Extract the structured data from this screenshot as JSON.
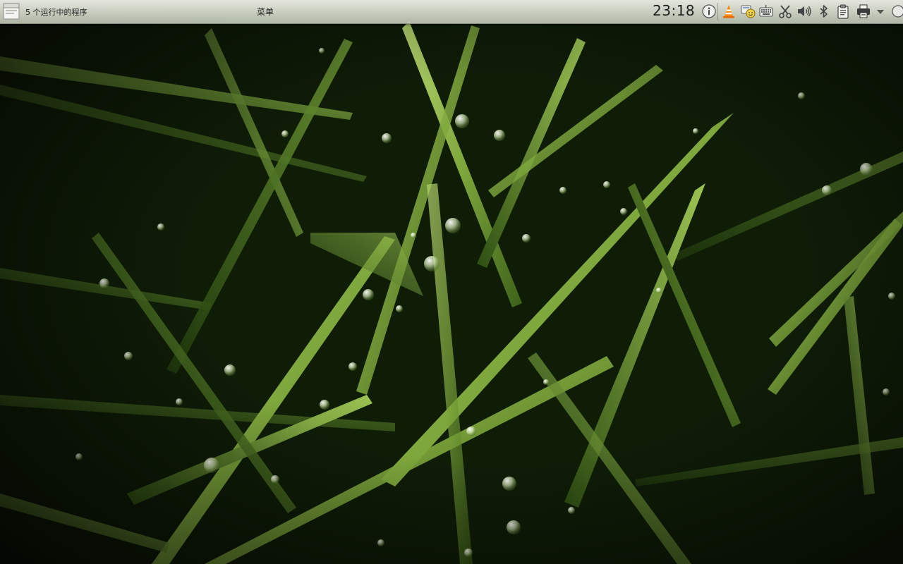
{
  "panel": {
    "running_programs": "5 个运行中的程序",
    "menu": "菜单",
    "clock": "23:18"
  },
  "tray_icons": [
    "info-icon",
    "vlc-icon",
    "chat-status-icon",
    "keyboard-icon",
    "scissors-icon",
    "volume-icon",
    "bluetooth-icon",
    "clipboard-icon",
    "printer-icon",
    "dropdown-arrow-icon"
  ],
  "colors": {
    "panel": "#e6ebdd",
    "grass_light": "#a6c95a",
    "grass_dark": "#2c4a12",
    "background": "#0b1405"
  }
}
